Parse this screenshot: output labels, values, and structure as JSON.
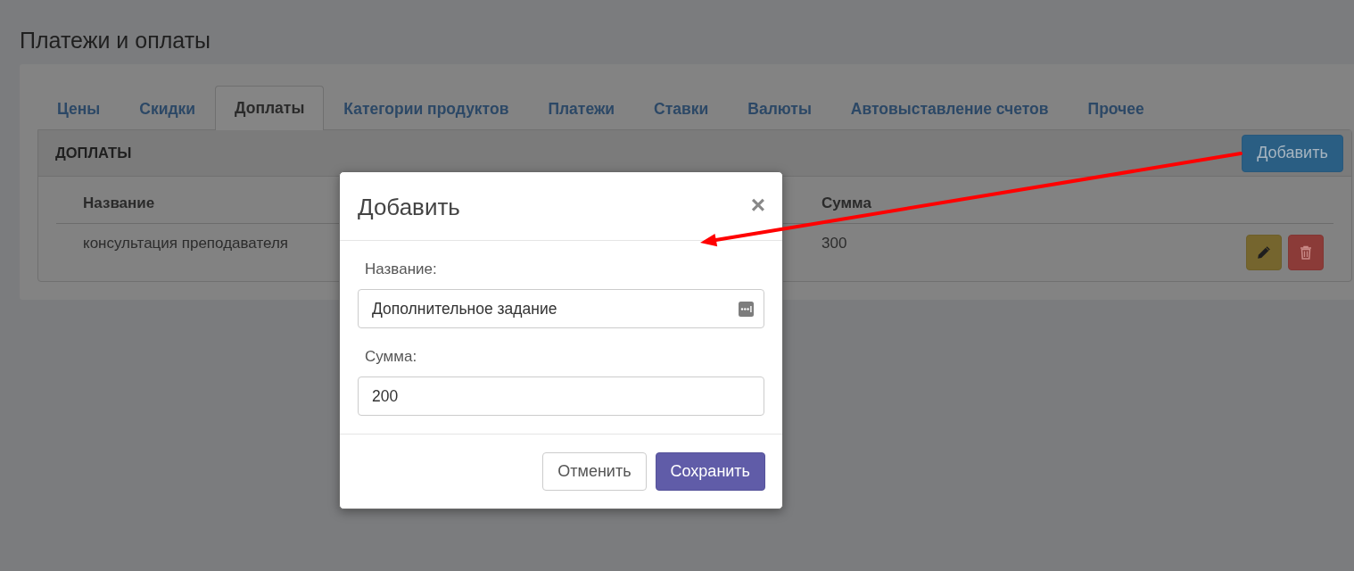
{
  "page": {
    "title": "Платежи и оплаты"
  },
  "tabs": [
    {
      "label": "Цены",
      "selected": false
    },
    {
      "label": "Скидки",
      "selected": false
    },
    {
      "label": "Доплаты",
      "selected": true
    },
    {
      "label": "Категории продуктов",
      "selected": false
    },
    {
      "label": "Платежи",
      "selected": false
    },
    {
      "label": "Ставки",
      "selected": false
    },
    {
      "label": "Валюты",
      "selected": false
    },
    {
      "label": "Автовыставление счетов",
      "selected": false
    },
    {
      "label": "Прочее",
      "selected": false
    }
  ],
  "panel": {
    "title": "ДОПЛАТЫ",
    "add_button": "Добавить"
  },
  "table": {
    "columns": [
      "Название",
      "Сумма"
    ],
    "rows": [
      {
        "cells": [
          "консультация преподавателя",
          "300"
        ],
        "actions": [
          {
            "kind": "edit"
          },
          {
            "kind": "delete"
          }
        ]
      }
    ]
  },
  "modal": {
    "title": "Добавить",
    "close": "×",
    "fields": [
      {
        "label": "Название:",
        "value": "Дополнительное задание",
        "kind": "text"
      },
      {
        "label": "Сумма:",
        "value": "200",
        "kind": "number"
      }
    ],
    "buttons": [
      {
        "label": "Отменить",
        "kind": "default"
      },
      {
        "label": "Сохранить",
        "kind": "primary"
      }
    ]
  }
}
